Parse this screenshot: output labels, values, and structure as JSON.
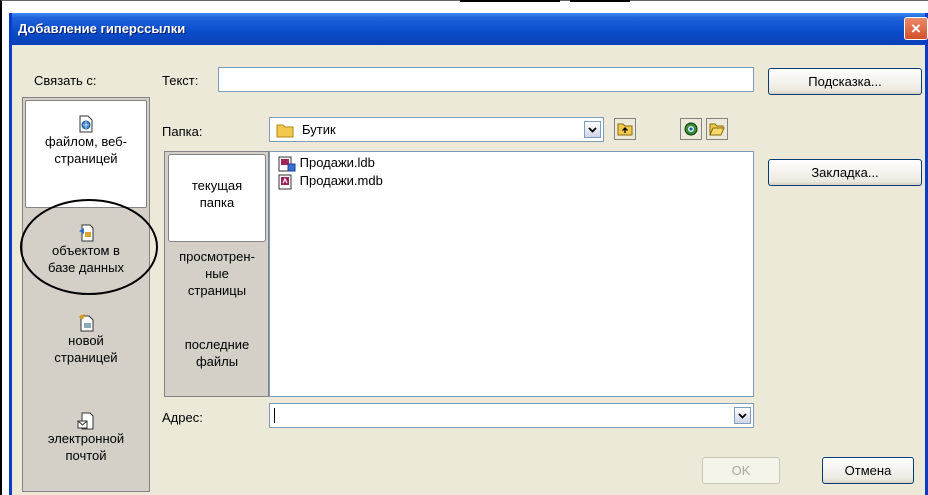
{
  "dialog": {
    "title": "Добавление гиперссылки",
    "close_glyph": "×"
  },
  "link_to": {
    "label": "Связать с:",
    "items": [
      {
        "line1": "файлом, веб-",
        "line2": "страницей",
        "icon": "web-page-icon",
        "selected": true
      },
      {
        "line1": "объектом в",
        "line2": "базе данных",
        "icon": "database-object-icon",
        "selected": false
      },
      {
        "line1": "новой",
        "line2": "страницей",
        "icon": "new-page-icon",
        "selected": false
      },
      {
        "line1": "электронной",
        "line2": "почтой",
        "icon": "email-icon",
        "selected": false
      }
    ]
  },
  "text_field": {
    "label": "Текст:",
    "value": ""
  },
  "buttons": {
    "hint": "Подсказка...",
    "bookmark": "Закладка...",
    "ok": "OK",
    "cancel": "Отмена"
  },
  "folder": {
    "label": "Папка:",
    "value": "Бутик",
    "icon": "folder-icon",
    "toolbar": [
      "up-folder-icon",
      "browse-web-icon",
      "browse-file-icon"
    ]
  },
  "look_in": [
    {
      "lines": [
        "текущая",
        "папка"
      ],
      "selected": true
    },
    {
      "lines": [
        "просмотрен-",
        "ные",
        "страницы"
      ],
      "selected": false
    },
    {
      "lines": [
        "последние",
        "файлы"
      ],
      "selected": false
    }
  ],
  "files": [
    {
      "name": "Продажи.ldb",
      "icon": "access-lock-file-icon"
    },
    {
      "name": "Продажи.mdb",
      "icon": "access-database-icon"
    }
  ],
  "address": {
    "label": "Адрес:",
    "value": ""
  }
}
